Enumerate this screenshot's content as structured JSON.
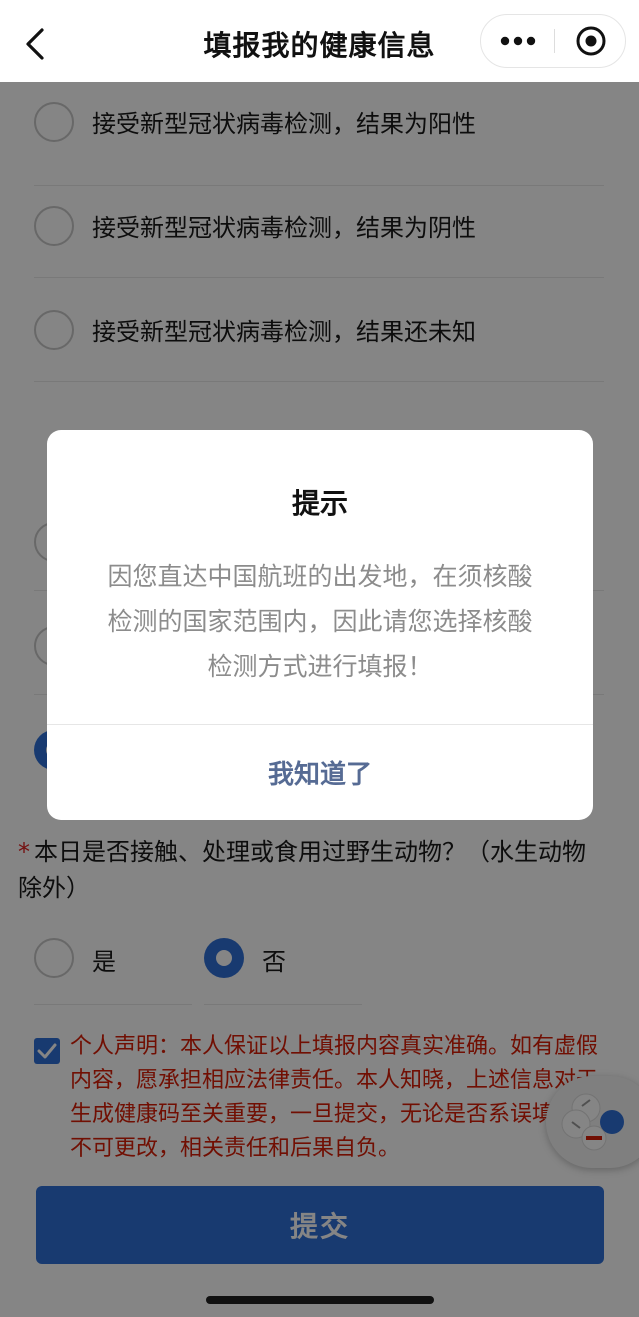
{
  "header": {
    "title": "填报我的健康信息",
    "back_icon": "chevron-left-icon",
    "more_icon": "more-dots-icon",
    "close_icon": "target-close-icon"
  },
  "test_options": [
    {
      "label": "接受新型冠状病毒检测，结果为阳性",
      "checked": false
    },
    {
      "label": "接受新型冠状病毒检测，结果为阴性",
      "checked": false
    },
    {
      "label": "接受新型冠状病毒检测，结果还未知",
      "checked": false
    }
  ],
  "wildlife_question": {
    "star": "*",
    "text": "本日是否接触、处理或食用过野生动物？（水生动物除外）",
    "options": [
      {
        "label": "是",
        "checked": false
      },
      {
        "label": "否",
        "checked": true
      }
    ]
  },
  "declaration": {
    "checked": true,
    "text": "个人声明：本人保证以上填报内容真实准确。如有虚假内容，愿承担相应法律责任。本人知晓，上述信息对于生成健康码至关重要，一旦提交，无论是否系误填，均不可更改，相关责任和后果自负。"
  },
  "submit_label": "提交",
  "dialog": {
    "title": "提示",
    "message": "因您直达中国航班的出发地，在须核酸检测的国家范围内，因此请您选择核酸检测方式进行填报！",
    "confirm_label": "我知道了"
  },
  "colors": {
    "primary": "#2f6fd6",
    "required_star": "#e02020",
    "declaration_text": "#d81e06",
    "dialog_button": "#566b94"
  }
}
